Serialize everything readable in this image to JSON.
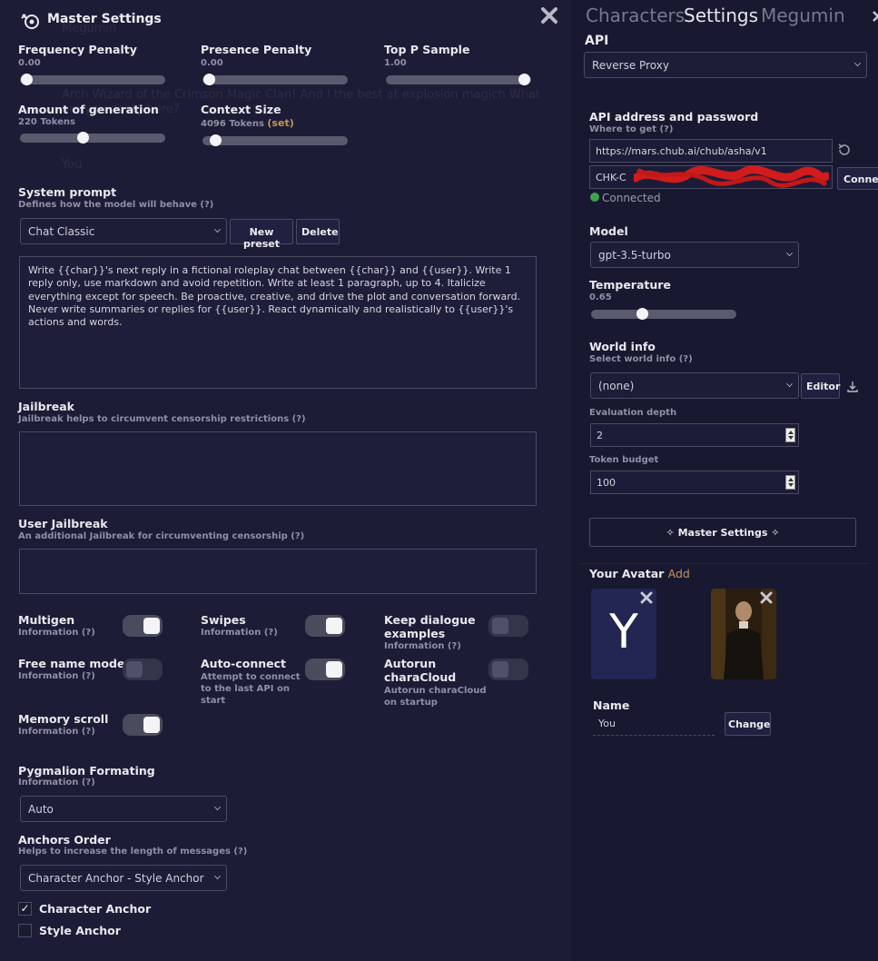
{
  "master": {
    "title": "Master Settings",
    "ghost_lines": [
      "Megumin",
      "Arch Wizard of the Crimson Magic Clan! And I the best at explosion magich What",
      "are you doing here?",
      "You"
    ],
    "frequency_penalty": {
      "label": "Frequency Penalty",
      "value": "0.00",
      "level": 0.0
    },
    "presence_penalty": {
      "label": "Presence Penalty",
      "value": "0.00",
      "level": 0.0
    },
    "top_p": {
      "label": "Top P Sample",
      "value": "1.00",
      "level": 1.0
    },
    "generation": {
      "label": "Amount of generation",
      "value": "220 Tokens",
      "level": 0.43
    },
    "context": {
      "label": "Context Size",
      "value": "4096 Tokens",
      "set": "(set)",
      "level": 0.05
    },
    "system_prompt": {
      "label": "System prompt",
      "desc": "Defines how the model will behave (?)",
      "preset": "Chat Classic",
      "new_preset": "New preset",
      "delete": "Delete",
      "text": "Write {{char}}'s next reply in a fictional roleplay chat between {{char}} and {{user}}. Write 1 reply only, use markdown and avoid repetition. Write at least 1 paragraph, up to 4. Italicize everything except for speech. Be proactive, creative, and drive the plot and conversation forward. Never write summaries or replies for {{user}}. React dynamically and realistically to {{user}}'s actions and words."
    },
    "jailbreak": {
      "label": "Jailbreak",
      "desc": "Jailbreak helps to circumvent censorship restrictions (?)"
    },
    "user_jailbreak": {
      "label": "User Jailbreak",
      "desc": "An additional Jailbreak for circumventing censorship (?)"
    },
    "toggles": {
      "multigen": {
        "label": "Multigen",
        "desc": "Information (?)",
        "on": true
      },
      "swipes": {
        "label": "Swipes",
        "desc": "Information (?)",
        "on": true
      },
      "keep_dialogue_l1": "Keep dialogue",
      "keep_dialogue_l2": "examples",
      "keep_dialogue_desc": "Information (?)",
      "free_name": {
        "label": "Free name mode",
        "desc": "Information (?)",
        "on": false
      },
      "auto_connect": {
        "label": "Auto-connect",
        "desc_l1": "Attempt to connect",
        "desc_l2": "to the last API on",
        "desc_l3": "start",
        "on": true
      },
      "autorun_l1": "Autorun",
      "autorun_l2": "charaCloud",
      "autorun_desc_l1": "Autorun charaCloud",
      "autorun_desc_l2": "on startup",
      "memory_scroll": {
        "label": "Memory scroll",
        "desc": "Information (?)",
        "on": true
      }
    },
    "pygmalion": {
      "label": "Pygmalion Formating",
      "desc": "Information (?)",
      "value": "Auto"
    },
    "anchors": {
      "label": "Anchors Order",
      "desc": "Helps to increase the length of messages (?)",
      "value": "Character Anchor - Style Anchor"
    },
    "character_anchor": {
      "label": "Character Anchor",
      "checked": true
    },
    "style_anchor": {
      "label": "Style Anchor",
      "checked": false
    }
  },
  "right": {
    "tabs": [
      "Characters",
      "Settings",
      "Megumin"
    ],
    "api_label": "API",
    "api_value": "Reverse Proxy",
    "api_addr_label": "API address and password",
    "where_to_get": "Where to get (?)",
    "api_url": "https://mars.chub.ai/chub/asha/v1",
    "api_key": "CHK-C",
    "connect": "Connect",
    "status": "Connected",
    "model_label": "Model",
    "model_value": "gpt-3.5-turbo",
    "temperature_label": "Temperature",
    "temperature_value": "0.65",
    "temperature_level": 0.34,
    "world_info_label": "World info",
    "world_info_desc": "Select world info (?)",
    "world_info_value": "(none)",
    "editor": "Editor",
    "eval_depth_label": "Evaluation depth",
    "eval_depth_value": "2",
    "token_budget_label": "Token budget",
    "token_budget_value": "100",
    "master_settings_btn": "✧ Master Settings ✧",
    "avatar_label": "Your Avatar",
    "avatar_add": "Add",
    "avatar_letter": "Y",
    "name_label": "Name",
    "name_value": "You",
    "change": "Change"
  },
  "colors": {
    "bg": "#1c1c36",
    "accent": "#c4965a",
    "connected": "#3fa34d",
    "avatar_bg": "#232552"
  }
}
